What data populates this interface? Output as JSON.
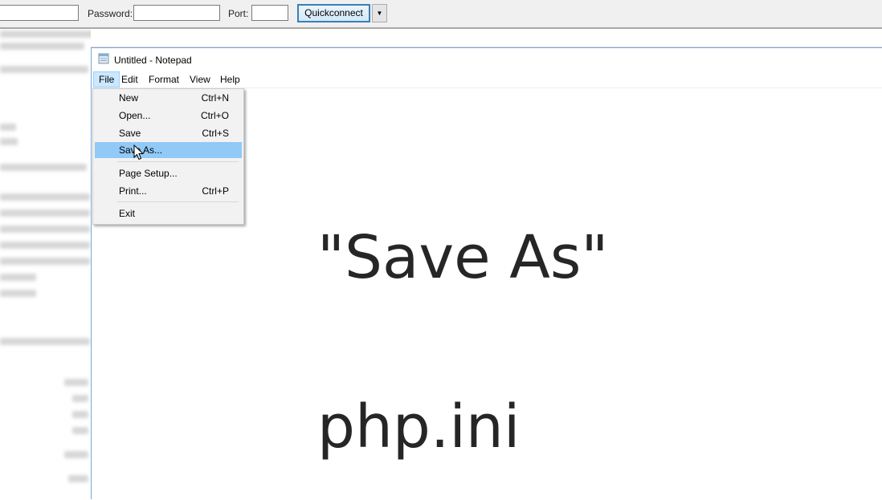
{
  "quickconnect": {
    "password_label": "Password:",
    "port_label": "Port:",
    "host_value": "",
    "password_value": "",
    "port_value": "",
    "button_label": "Quickconnect",
    "dropdown_icon": "caret-down-icon"
  },
  "notepad": {
    "title": "Untitled - Notepad",
    "menu": [
      {
        "label": "File"
      },
      {
        "label": "Edit"
      },
      {
        "label": "Format"
      },
      {
        "label": "View"
      },
      {
        "label": "Help"
      }
    ],
    "active_menu": "File",
    "file_menu": [
      {
        "label": "New",
        "shortcut": "Ctrl+N"
      },
      {
        "label": "Open...",
        "shortcut": "Ctrl+O"
      },
      {
        "label": "Save",
        "shortcut": "Ctrl+S"
      },
      {
        "label": "Save As...",
        "shortcut": "",
        "highlighted": true
      },
      {
        "label": "Page Setup...",
        "shortcut": ""
      },
      {
        "label": "Print...",
        "shortcut": "Ctrl+P"
      },
      {
        "label": "Exit",
        "shortcut": ""
      }
    ]
  },
  "overlay": {
    "line1": "\"Save As\"",
    "line2": "php.ini"
  },
  "colors": {
    "highlight": "#91c9f7",
    "active_menu_bg": "#cce8ff",
    "quickconnect_border": "#3c7fb1",
    "overlay_text": "#262626"
  }
}
